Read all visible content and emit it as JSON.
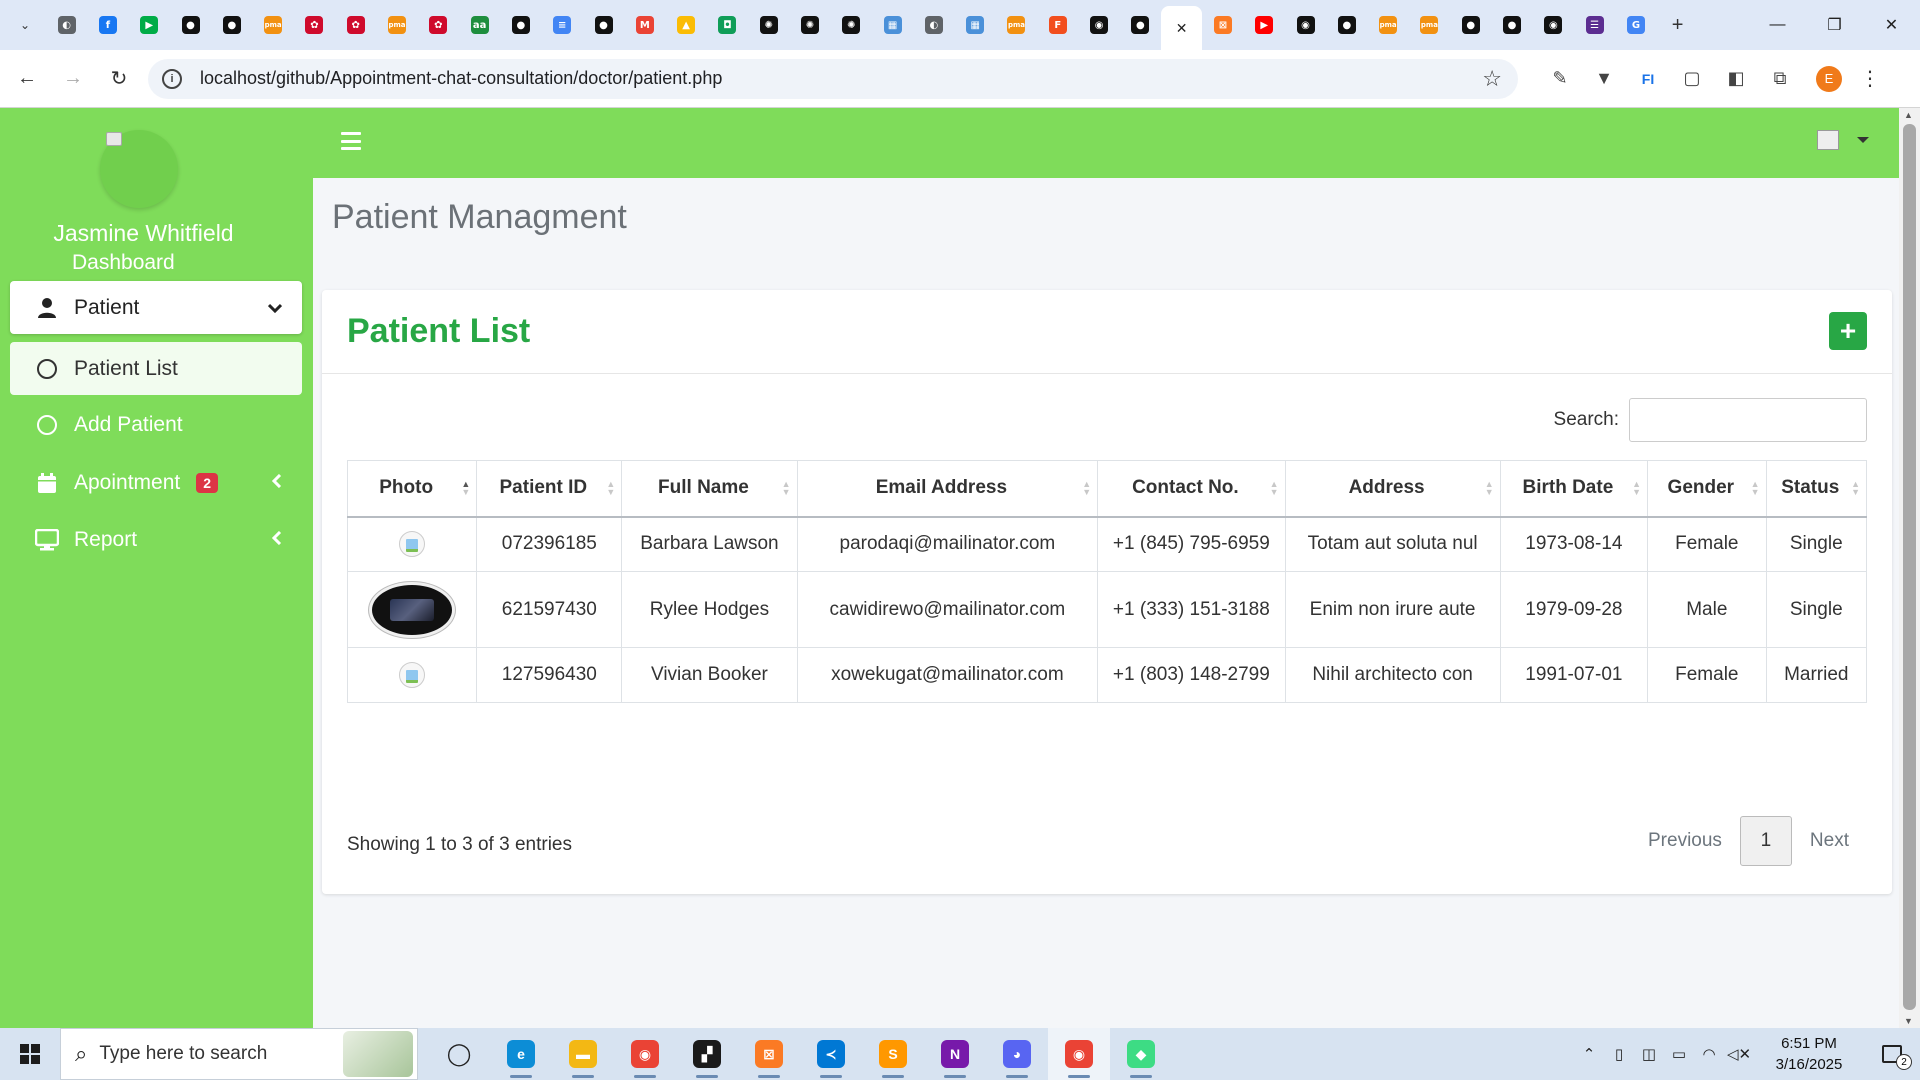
{
  "browser": {
    "tabs": [
      {
        "icon": "web-icon",
        "color": "#5f6368",
        "glyph": "◐"
      },
      {
        "icon": "facebook-icon",
        "color": "#1877f2",
        "glyph": "f"
      },
      {
        "icon": "google-meet-icon",
        "color": "#00ac47",
        "glyph": "▶"
      },
      {
        "icon": "app-icon",
        "color": "#111111",
        "glyph": "●"
      },
      {
        "icon": "app-icon",
        "color": "#111111",
        "glyph": "●"
      },
      {
        "icon": "phpmyadmin-icon",
        "color": "#f29111",
        "glyph": "pma"
      },
      {
        "icon": "huawei-icon",
        "color": "#cf0a2c",
        "glyph": "✿"
      },
      {
        "icon": "huawei-icon",
        "color": "#cf0a2c",
        "glyph": "✿"
      },
      {
        "icon": "phpmyadmin-icon",
        "color": "#f29111",
        "glyph": "pma"
      },
      {
        "icon": "huawei-icon",
        "color": "#cf0a2c",
        "glyph": "✿"
      },
      {
        "icon": "aa-icon",
        "color": "#1e8e3e",
        "glyph": "aa"
      },
      {
        "icon": "app-icon",
        "color": "#111111",
        "glyph": "●"
      },
      {
        "icon": "google-docs-icon",
        "color": "#4285f4",
        "glyph": "≡"
      },
      {
        "icon": "app-icon",
        "color": "#111111",
        "glyph": "●"
      },
      {
        "icon": "gmail-icon",
        "color": "#ea4335",
        "glyph": "M"
      },
      {
        "icon": "google-drive-icon",
        "color": "#fbbc04",
        "glyph": "▲"
      },
      {
        "icon": "app-icon",
        "color": "#0f9d58",
        "glyph": "◘"
      },
      {
        "icon": "openai-icon",
        "color": "#111111",
        "glyph": "✺"
      },
      {
        "icon": "openai-icon",
        "color": "#111111",
        "glyph": "✺"
      },
      {
        "icon": "openai-icon",
        "color": "#111111",
        "glyph": "✺"
      },
      {
        "icon": "calendar-icon",
        "color": "#4a90d9",
        "glyph": "▦"
      },
      {
        "icon": "web-icon",
        "color": "#5f6368",
        "glyph": "◐"
      },
      {
        "icon": "calendar-icon",
        "color": "#4a90d9",
        "glyph": "▦"
      },
      {
        "icon": "phpmyadmin-icon",
        "color": "#f29111",
        "glyph": "pma"
      },
      {
        "icon": "figma-icon",
        "color": "#f24e1e",
        "glyph": "F"
      },
      {
        "icon": "github-icon",
        "color": "#111111",
        "glyph": "◉"
      },
      {
        "icon": "app-icon",
        "color": "#111111",
        "glyph": "●"
      },
      {
        "icon": "close-tab-icon",
        "color": "#ffffff",
        "glyph": "✕",
        "active": true
      },
      {
        "icon": "xampp-icon",
        "color": "#fb7a24",
        "glyph": "⊠"
      },
      {
        "icon": "youtube-icon",
        "color": "#ff0000",
        "glyph": "▶"
      },
      {
        "icon": "github-icon",
        "color": "#111111",
        "glyph": "◉"
      },
      {
        "icon": "app-icon",
        "color": "#111111",
        "glyph": "●"
      },
      {
        "icon": "phpmyadmin-icon",
        "color": "#f29111",
        "glyph": "pma"
      },
      {
        "icon": "phpmyadmin-icon",
        "color": "#f29111",
        "glyph": "pma"
      },
      {
        "icon": "app-icon",
        "color": "#111111",
        "glyph": "●"
      },
      {
        "icon": "app-icon",
        "color": "#111111",
        "glyph": "●"
      },
      {
        "icon": "github-icon",
        "color": "#111111",
        "glyph": "◉"
      },
      {
        "icon": "list-icon",
        "color": "#5c2d91",
        "glyph": "☰"
      },
      {
        "icon": "google-icon",
        "color": "#4285f4",
        "glyph": "G"
      }
    ],
    "url": "localhost/github/Appointment-chat-consultation/doctor/patient.php",
    "profile_initial": "E"
  },
  "sidebar": {
    "user_name": "Jasmine Whitfield",
    "dashboard": "Dashboard",
    "patient": "Patient",
    "patient_list": "Patient List",
    "add_patient": "Add Patient",
    "appointment": "Apointment",
    "appointment_badge": "2",
    "report": "Report"
  },
  "page": {
    "title": "Patient Managment",
    "card_title": "Patient List",
    "search_label": "Search:",
    "search_value": "",
    "info": "Showing 1 to 3 of 3 entries",
    "prev": "Previous",
    "current_page": "1",
    "next": "Next"
  },
  "table": {
    "headers": [
      "Photo",
      "Patient ID",
      "Full Name",
      "Email Address",
      "Contact No.",
      "Address",
      "Birth Date",
      "Gender",
      "Status"
    ],
    "rows": [
      {
        "photo": "placeholder",
        "id": "072396185",
        "name": "Barbara Lawson",
        "email": "parodaqi@mailinator.com",
        "contact": "+1 (845) 795-6959",
        "address": "Totam aut soluta nul",
        "birth": "1973-08-14",
        "gender": "Female",
        "status": "Single"
      },
      {
        "photo": "image",
        "id": "621597430",
        "name": "Rylee Hodges",
        "email": "cawidirewo@mailinator.com",
        "contact": "+1 (333) 151-3188",
        "address": "Enim non irure aute",
        "birth": "1979-09-28",
        "gender": "Male",
        "status": "Single"
      },
      {
        "photo": "placeholder",
        "id": "127596430",
        "name": "Vivian Booker",
        "email": "xowekugat@mailinator.com",
        "contact": "+1 (803) 148-2799",
        "address": "Nihil architecto con",
        "birth": "1991-07-01",
        "gender": "Female",
        "status": "Married"
      }
    ]
  },
  "taskbar": {
    "search_placeholder": "Type here to search",
    "apps": [
      {
        "name": "task-view-icon",
        "color": "#222222",
        "glyph": "◯"
      },
      {
        "name": "edge-icon",
        "color": "#0c8dd6",
        "glyph": "e"
      },
      {
        "name": "file-explorer-icon",
        "color": "#f3b814",
        "glyph": "▬"
      },
      {
        "name": "chrome-icon",
        "color": "#ea4335",
        "glyph": "◉"
      },
      {
        "name": "sticky-notes-icon",
        "color": "#1a1a1a",
        "glyph": "▞"
      },
      {
        "name": "xampp-icon",
        "color": "#fb7a24",
        "glyph": "⊠"
      },
      {
        "name": "vscode-icon",
        "color": "#0078d4",
        "glyph": "≺"
      },
      {
        "name": "sublime-icon",
        "color": "#ff9800",
        "glyph": "S"
      },
      {
        "name": "onenote-icon",
        "color": "#7719aa",
        "glyph": "N"
      },
      {
        "name": "discord-icon",
        "color": "#5865f2",
        "glyph": "◕"
      },
      {
        "name": "chrome-profile-icon",
        "color": "#ea4335",
        "glyph": "◉"
      },
      {
        "name": "git-icon",
        "color": "#3ddc84",
        "glyph": "◆"
      }
    ],
    "time": "6:51 PM",
    "date": "3/16/2025",
    "notifications": "2"
  },
  "colors": {
    "sidebar_green": "#7fdc5a",
    "title_green": "#28a745",
    "badge_red": "#dc3545"
  }
}
